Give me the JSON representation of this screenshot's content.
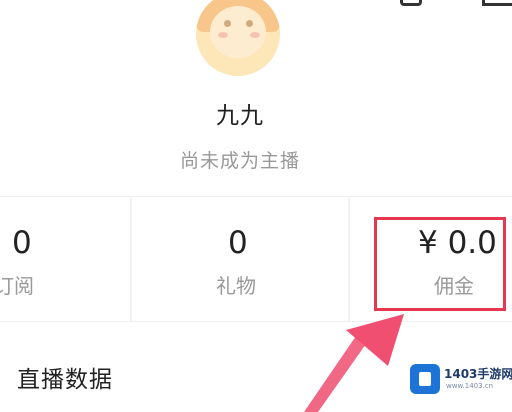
{
  "profile": {
    "username": "九九",
    "status": "尚未成为主播"
  },
  "stats": {
    "subscriptions": {
      "value": "0",
      "label": "订阅"
    },
    "gifts": {
      "value": "0",
      "label": "礼物"
    },
    "commission": {
      "value": "¥ 0.0",
      "label": "佣金"
    }
  },
  "section": {
    "title": "直播数据"
  },
  "watermark": {
    "name": "1403手游网",
    "url": "www.1403.cn"
  },
  "colors": {
    "highlight": "#e5374f",
    "arrow": "#ee4d6e"
  },
  "icons": {
    "top_left": "edit-icon",
    "top_right": "settings-icon"
  }
}
